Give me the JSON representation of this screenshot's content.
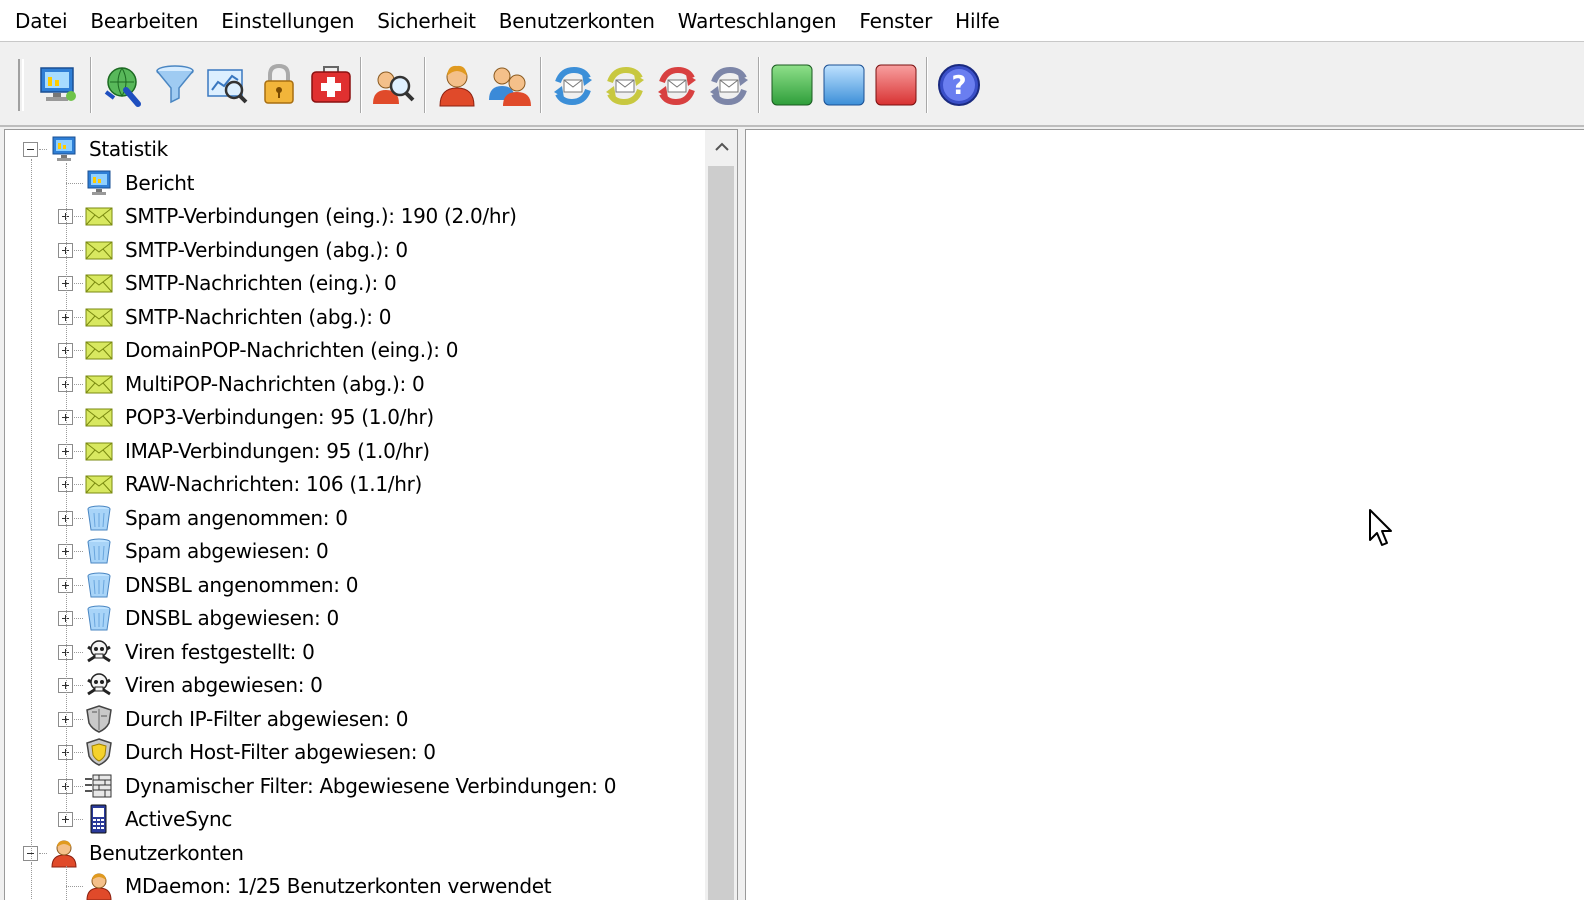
{
  "menu": [
    "Datei",
    "Bearbeiten",
    "Einstellungen",
    "Sicherheit",
    "Benutzerkonten",
    "Warteschlangen",
    "Fenster",
    "Hilfe"
  ],
  "toolbar": {
    "buttons": [
      {
        "name": "statistics-monitor-icon"
      },
      {
        "name": "domain-manager-icon"
      },
      {
        "name": "content-filter-icon"
      },
      {
        "name": "spam-filter-icon"
      },
      {
        "name": "security-lock-icon"
      },
      {
        "name": "first-aid-icon"
      },
      {
        "name": "user-search-icon"
      },
      {
        "name": "single-user-icon"
      },
      {
        "name": "user-group-icon"
      },
      {
        "name": "queue-blue-refresh-icon"
      },
      {
        "name": "queue-yellow-refresh-icon"
      },
      {
        "name": "queue-red-refresh-icon"
      },
      {
        "name": "queue-gray-refresh-icon"
      },
      {
        "name": "green-status-icon"
      },
      {
        "name": "blue-status-icon"
      },
      {
        "name": "red-status-icon"
      },
      {
        "name": "help-icon"
      }
    ],
    "colors": {
      "green": "#2e9e3a",
      "blue": "#3c8fd8",
      "red": "#d83232",
      "help": "#3a4fc8"
    }
  },
  "tree": {
    "root": {
      "label": "Statistik",
      "icon": "monitor-icon"
    },
    "items": [
      {
        "label": "Bericht",
        "icon": "monitor-icon",
        "expandable": false
      },
      {
        "label": "SMTP-Verbindungen (eing.): 190  (2.0/hr)",
        "icon": "envelope-icon",
        "expandable": true
      },
      {
        "label": "SMTP-Verbindungen (abg.): 0",
        "icon": "envelope-icon",
        "expandable": true
      },
      {
        "label": "SMTP-Nachrichten (eing.): 0",
        "icon": "envelope-icon",
        "expandable": true
      },
      {
        "label": "SMTP-Nachrichten (abg.): 0",
        "icon": "envelope-icon",
        "expandable": true
      },
      {
        "label": "DomainPOP-Nachrichten (eing.): 0",
        "icon": "envelope-icon",
        "expandable": true
      },
      {
        "label": "MultiPOP-Nachrichten (abg.): 0",
        "icon": "envelope-icon",
        "expandable": true
      },
      {
        "label": "POP3-Verbindungen: 95  (1.0/hr)",
        "icon": "envelope-icon",
        "expandable": true
      },
      {
        "label": "IMAP-Verbindungen: 95  (1.0/hr)",
        "icon": "envelope-icon",
        "expandable": true
      },
      {
        "label": "RAW-Nachrichten: 106  (1.1/hr)",
        "icon": "envelope-icon",
        "expandable": true
      },
      {
        "label": "Spam angenommen: 0",
        "icon": "trash-bin-icon",
        "expandable": true
      },
      {
        "label": "Spam abgewiesen: 0",
        "icon": "trash-bin-icon",
        "expandable": true
      },
      {
        "label": "DNSBL angenommen: 0",
        "icon": "trash-bin-icon",
        "expandable": true
      },
      {
        "label": "DNSBL abgewiesen: 0",
        "icon": "trash-bin-icon",
        "expandable": true
      },
      {
        "label": "Viren festgestellt: 0",
        "icon": "skull-icon",
        "expandable": true
      },
      {
        "label": "Viren abgewiesen: 0",
        "icon": "skull-icon",
        "expandable": true
      },
      {
        "label": "Durch IP-Filter abgewiesen: 0",
        "icon": "shield-icon",
        "expandable": true
      },
      {
        "label": "Durch Host-Filter abgewiesen: 0",
        "icon": "shield-yellow-icon",
        "expandable": true
      },
      {
        "label": "Dynamischer Filter: Abgewiesene Verbindungen: 0",
        "icon": "firewall-icon",
        "expandable": true
      },
      {
        "label": "ActiveSync",
        "icon": "mobile-device-icon",
        "expandable": true
      }
    ],
    "root2": {
      "label": "Benutzerkonten",
      "icon": "user-icon"
    },
    "items2": [
      {
        "label": "MDaemon: 1/25 Benutzerkonten verwendet",
        "icon": "user-icon",
        "expandable": false
      }
    ]
  }
}
